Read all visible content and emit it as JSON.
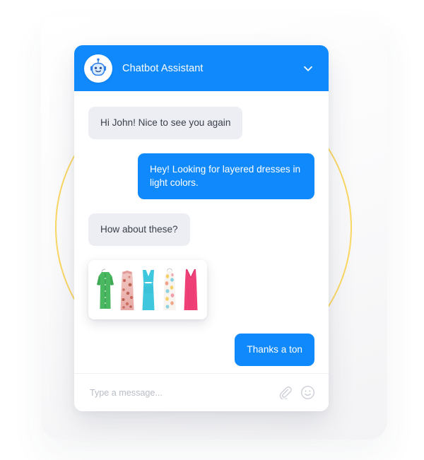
{
  "header": {
    "title": "Chatbot Assistant",
    "avatar_icon": "robot-avatar-icon",
    "collapse_icon": "chevron-down-icon",
    "background_color": "#1089FC"
  },
  "conversation": {
    "messages": [
      {
        "id": "m1",
        "sender": "bot",
        "text": "Hi John! Nice to see you again"
      },
      {
        "id": "m2",
        "sender": "user",
        "text": "Hey! Looking for layered dresses in light colors."
      },
      {
        "id": "m3",
        "sender": "bot",
        "text": "How about these?"
      },
      {
        "id": "m4",
        "sender": "user",
        "text": "Thanks a ton"
      }
    ],
    "product_gallery": {
      "items": [
        {
          "name": "green-button-front-dress",
          "color": "#4ab860"
        },
        {
          "name": "pink-floral-slip-dress",
          "color": "#e8b5ae"
        },
        {
          "name": "turquoise-cutout-dress",
          "color": "#3fc7dd"
        },
        {
          "name": "white-printed-maxi-dress",
          "color": "#f4f2ee"
        },
        {
          "name": "pink-v-neck-maxi-dress",
          "color": "#ef4178"
        }
      ]
    }
  },
  "composer": {
    "placeholder": "Type a message...",
    "value": "",
    "attach_icon": "paperclip-icon",
    "emoji_icon": "smiley-icon"
  },
  "decoration": {
    "ring_color": "#FBD863",
    "panel_name": "background-panel"
  },
  "theme": {
    "accent": "#1089FC",
    "bot_bubble": "#ECEEF3",
    "bot_text": "#3A3F4B",
    "user_text": "#FFFFFF"
  }
}
